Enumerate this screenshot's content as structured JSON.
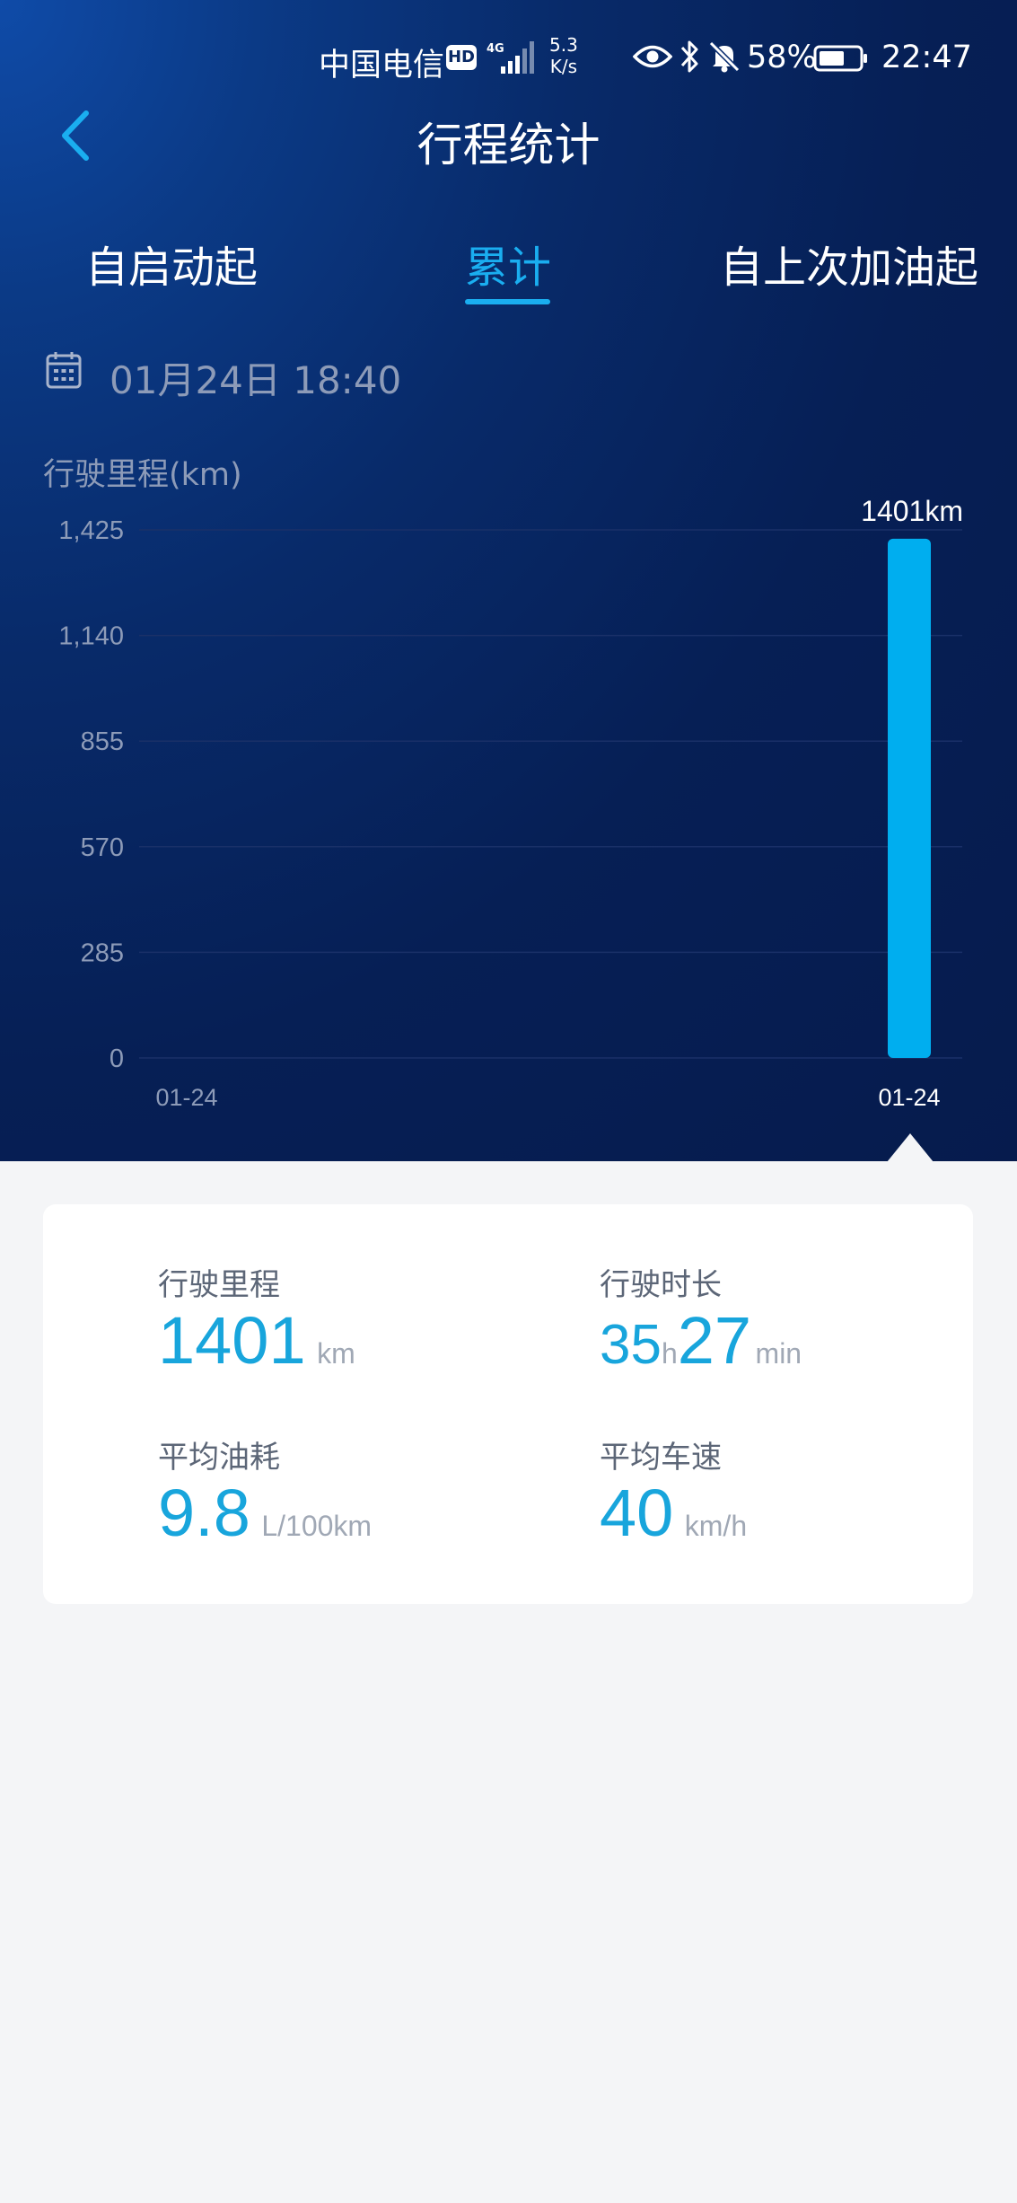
{
  "status_bar": {
    "carrier": "中国电信",
    "hd": "HD",
    "network": "4G",
    "speed_value": "5.3",
    "speed_unit": "K/s",
    "battery_percent": "58%",
    "time": "22:47"
  },
  "header": {
    "title": "行程统计"
  },
  "tabs": [
    {
      "label": "自启动起",
      "active": false
    },
    {
      "label": "累计",
      "active": true
    },
    {
      "label": "自上次加油起",
      "active": false
    }
  ],
  "date_row": {
    "text": "01月24日 18:40"
  },
  "chart_data": {
    "type": "bar",
    "ylabel": "行驶里程(km)",
    "yticks": [
      "1,425",
      "1,140",
      "855",
      "570",
      "285",
      "0"
    ],
    "ylim": [
      0,
      1425
    ],
    "categories": [
      "01-24",
      "01-24"
    ],
    "values": [
      0,
      1401
    ],
    "data_label": "1401km",
    "selected_index": 1,
    "grid": true,
    "colors": {
      "bar": "#00aeef",
      "grid": "#1a3068",
      "tick": "#8d9bb8"
    }
  },
  "stats": {
    "mileage": {
      "label": "行驶里程",
      "value": "1401",
      "unit": "km"
    },
    "duration": {
      "label": "行驶时长",
      "hours": "35",
      "hours_unit": "h",
      "minutes": "27",
      "minutes_unit": "min"
    },
    "fuel": {
      "label": "平均油耗",
      "value": "9.8",
      "unit": "L/100km"
    },
    "speed": {
      "label": "平均车速",
      "value": "40",
      "unit": "km/h"
    }
  }
}
